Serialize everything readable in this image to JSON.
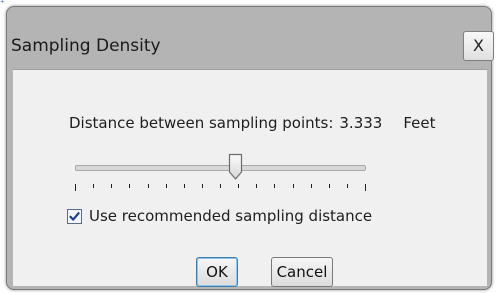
{
  "dialog": {
    "title": "Sampling Density",
    "close_label": "X"
  },
  "distance": {
    "label": "Distance between sampling points:",
    "value": "3.333",
    "unit": "Feet"
  },
  "slider": {
    "position_fraction": 0.55,
    "tick_count": 17
  },
  "checkbox": {
    "label": "Use recommended sampling distance",
    "checked": true
  },
  "buttons": {
    "ok_label": "OK",
    "cancel_label": "Cancel"
  },
  "colors": {
    "accent": "#3c7fb1",
    "check": "#1f3f8f"
  }
}
